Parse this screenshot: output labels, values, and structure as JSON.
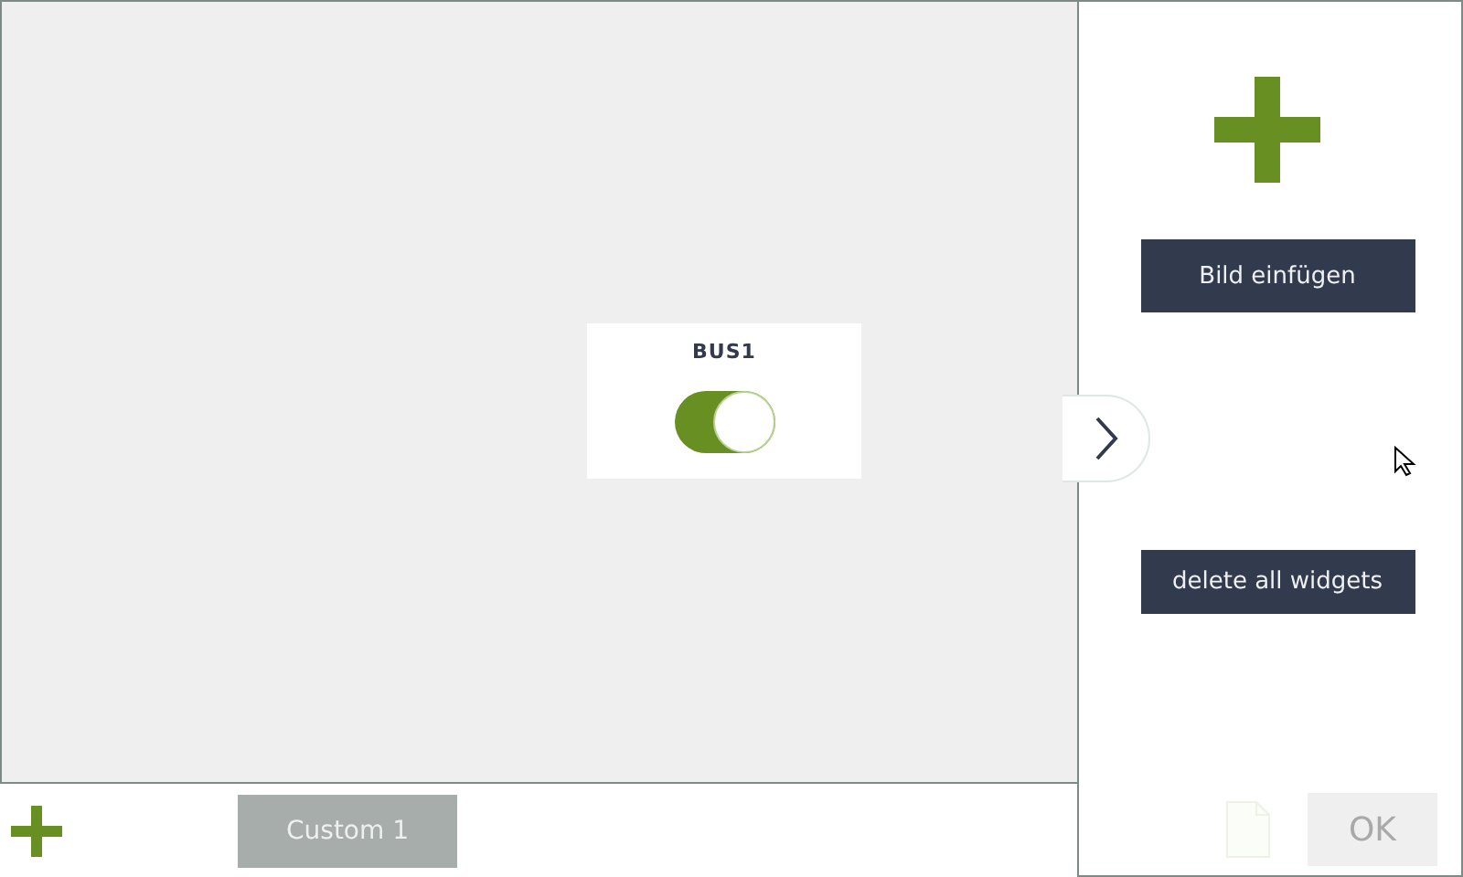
{
  "canvas": {
    "widgets": [
      {
        "kind": "switch",
        "title": "BUS1",
        "on": true
      }
    ]
  },
  "side_panel": {
    "buttons": [
      "Bild einfügen",
      "delete all widgets"
    ],
    "ok_button": {
      "label": "OK",
      "disabled": true
    }
  },
  "pages": [
    {
      "label": "Custom 1",
      "selected": true
    }
  ]
}
